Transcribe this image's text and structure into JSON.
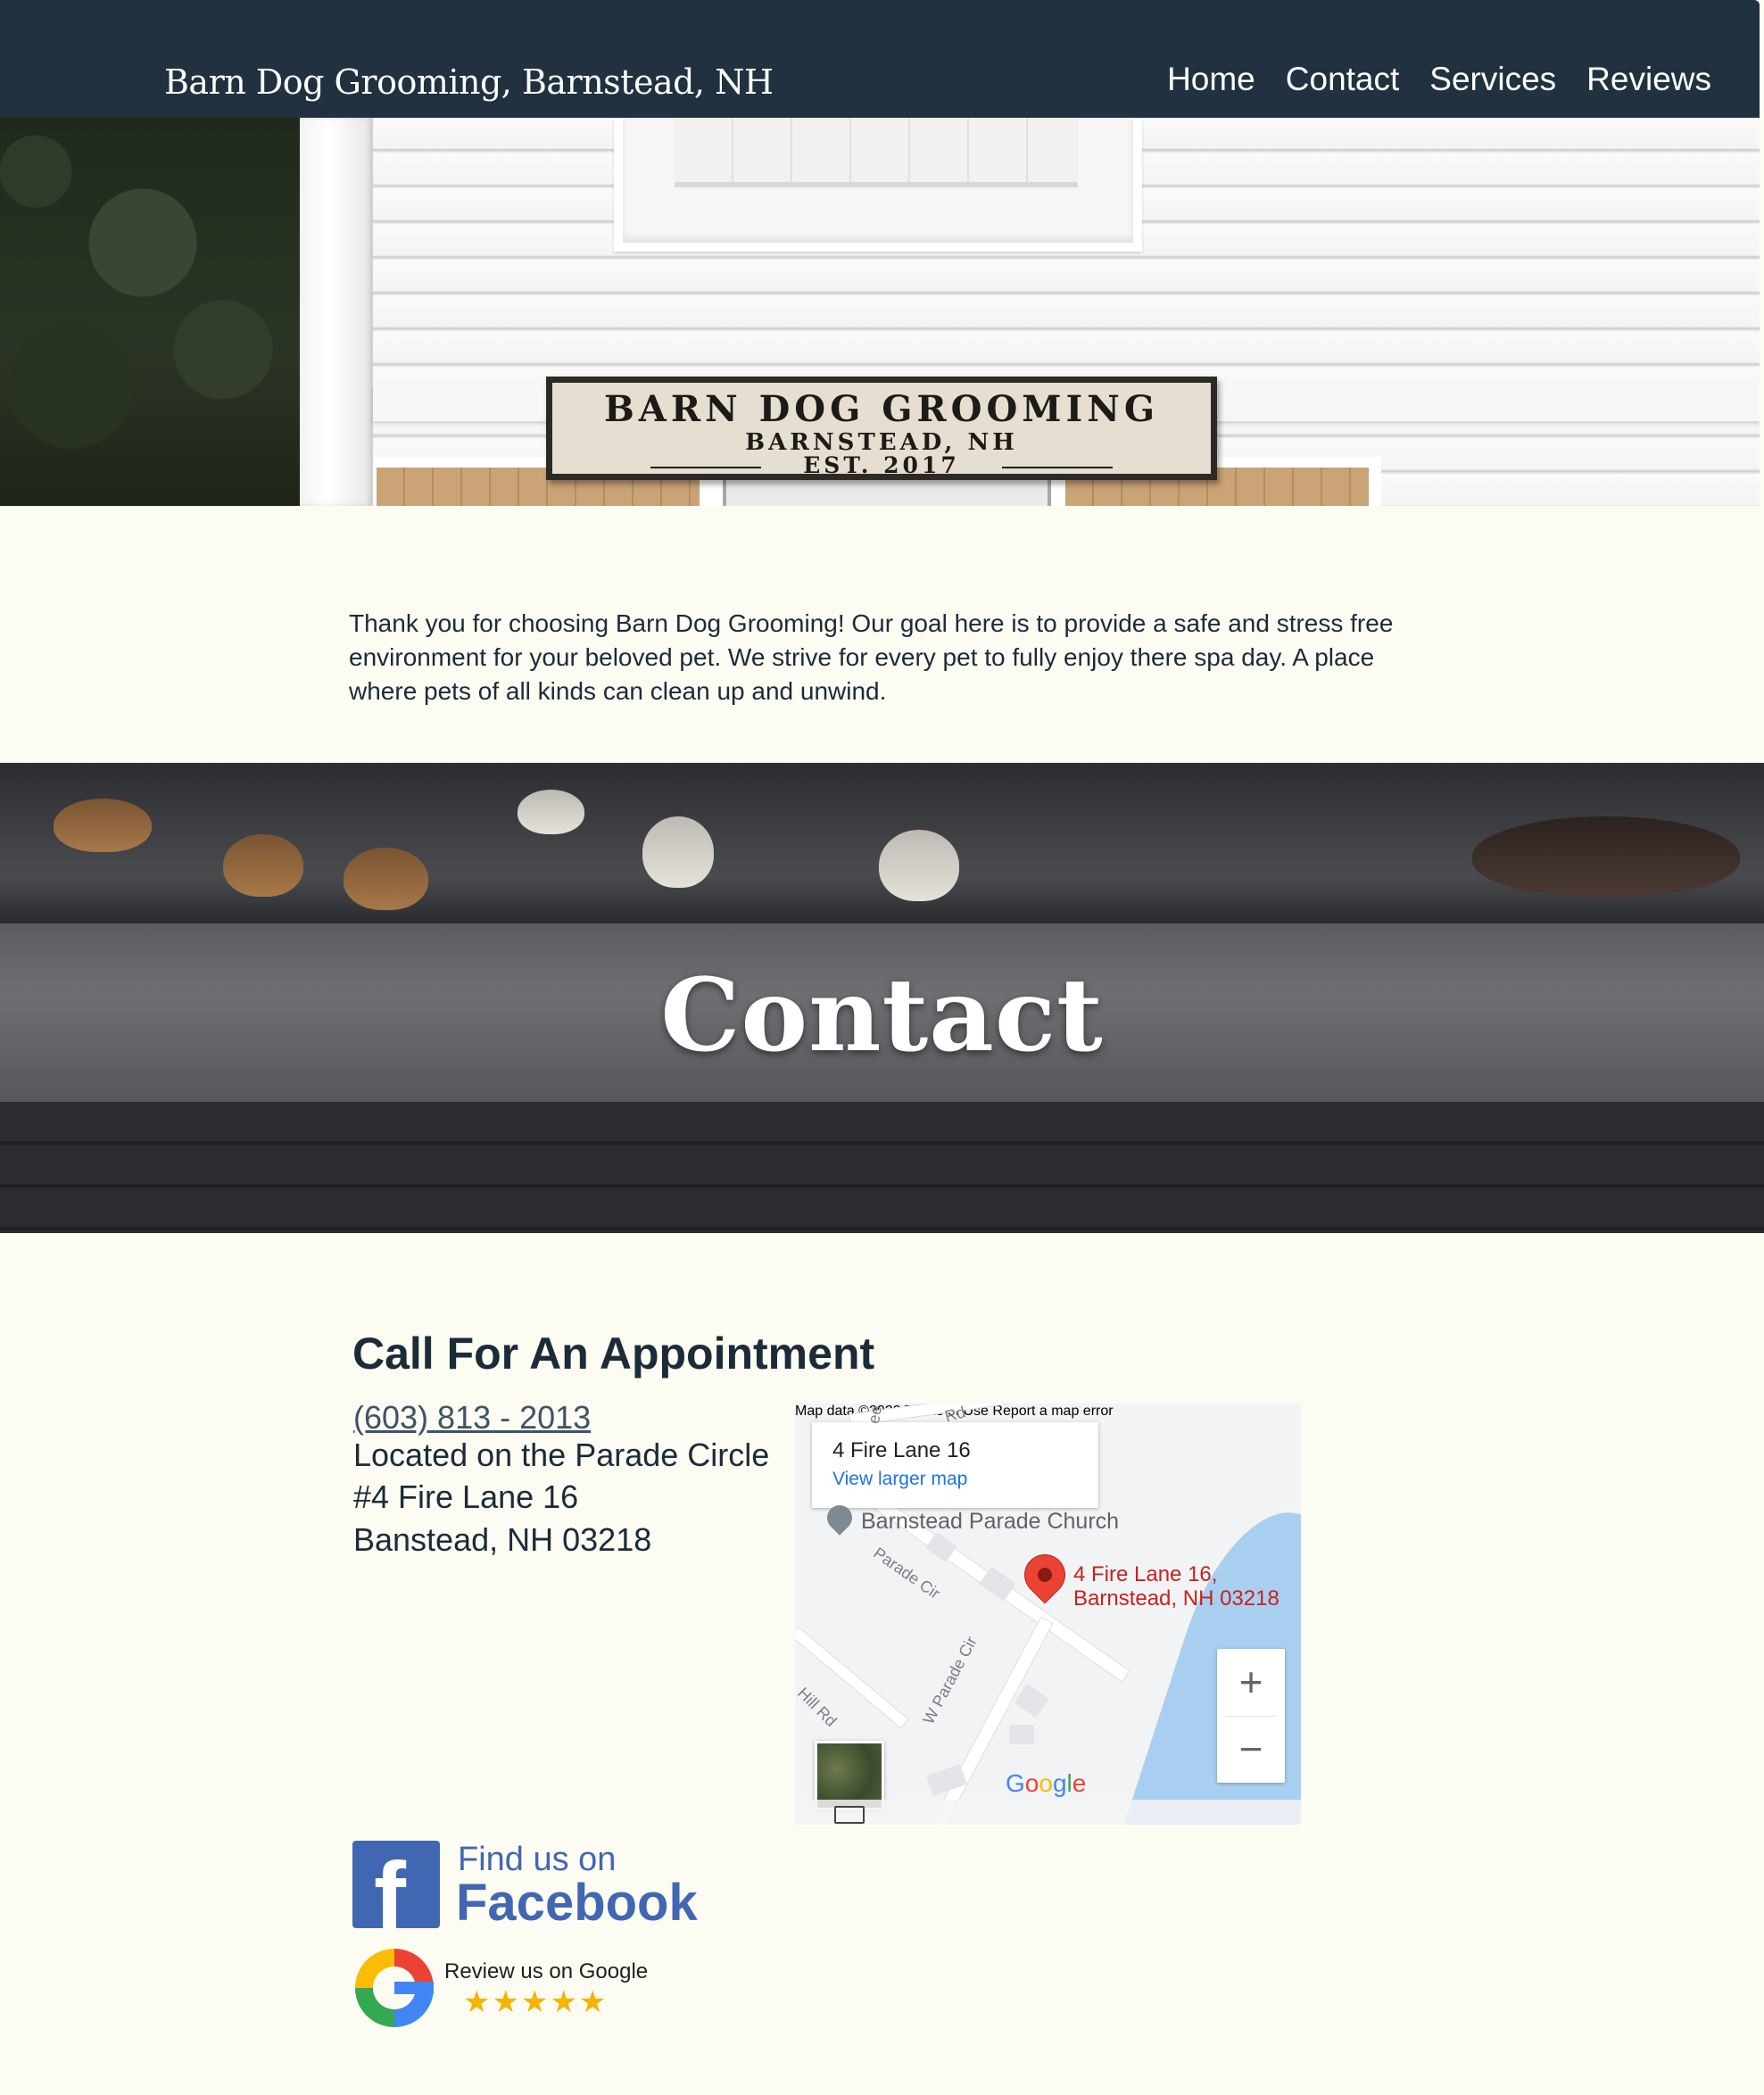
{
  "header": {
    "site_title": "Barn Dog Grooming, Barnstead, NH",
    "nav": [
      "Home",
      "Contact",
      "Services",
      "Reviews"
    ]
  },
  "hero_sign": {
    "line1": "BARN DOG GROOMING",
    "line2": "BARNSTEAD, NH",
    "line3": "EST. 2017"
  },
  "intro": {
    "text": "Thank you for choosing Barn Dog Grooming! Our goal here is to provide a safe and stress free environment for your beloved pet. We strive for every pet to fully enjoy there spa day. A place where pets of all kinds can clean up and unwind."
  },
  "banner": {
    "title": "Contact"
  },
  "contact": {
    "heading": "Call For An Appointment",
    "phone": "(603) 813 - 2013",
    "address_lines": [
      "Located on the Parade Circle",
      "#4 Fire Lane 16",
      "Banstead, NH 03218"
    ]
  },
  "map": {
    "info_title": "4 Fire Lane 16",
    "info_link": "View larger map",
    "church_label": "Barnstead Parade Church",
    "marker_label_line1": "4 Fire Lane 16,",
    "marker_label_line2": "Barnstead, NH 03218",
    "streets": [
      "Parade Cir",
      "W Parade Cir",
      "Hill Rd",
      "Rd",
      "ee"
    ],
    "zoom_in": "+",
    "zoom_out": "−",
    "google_logo": "Google",
    "attribution": {
      "map_data": "Map data ©2022",
      "terms": "Terms of Use",
      "report": "Report a map error"
    }
  },
  "social": {
    "facebook_line1": "Find us on",
    "facebook_line2": "Facebook",
    "facebook_icon": "f",
    "google_text": "Review us on Google",
    "google_stars": "★★★★★"
  },
  "colors": {
    "header_bg": "#213140",
    "page_bg": "#fcfcf3",
    "text": "#1c2b38",
    "facebook_blue": "#4267b2",
    "map_marker": "#ea4335"
  },
  "icons": [
    "facebook-icon",
    "google-icon",
    "map-pin-icon",
    "church-pin-icon",
    "keyboard-icon",
    "star-icon"
  ]
}
